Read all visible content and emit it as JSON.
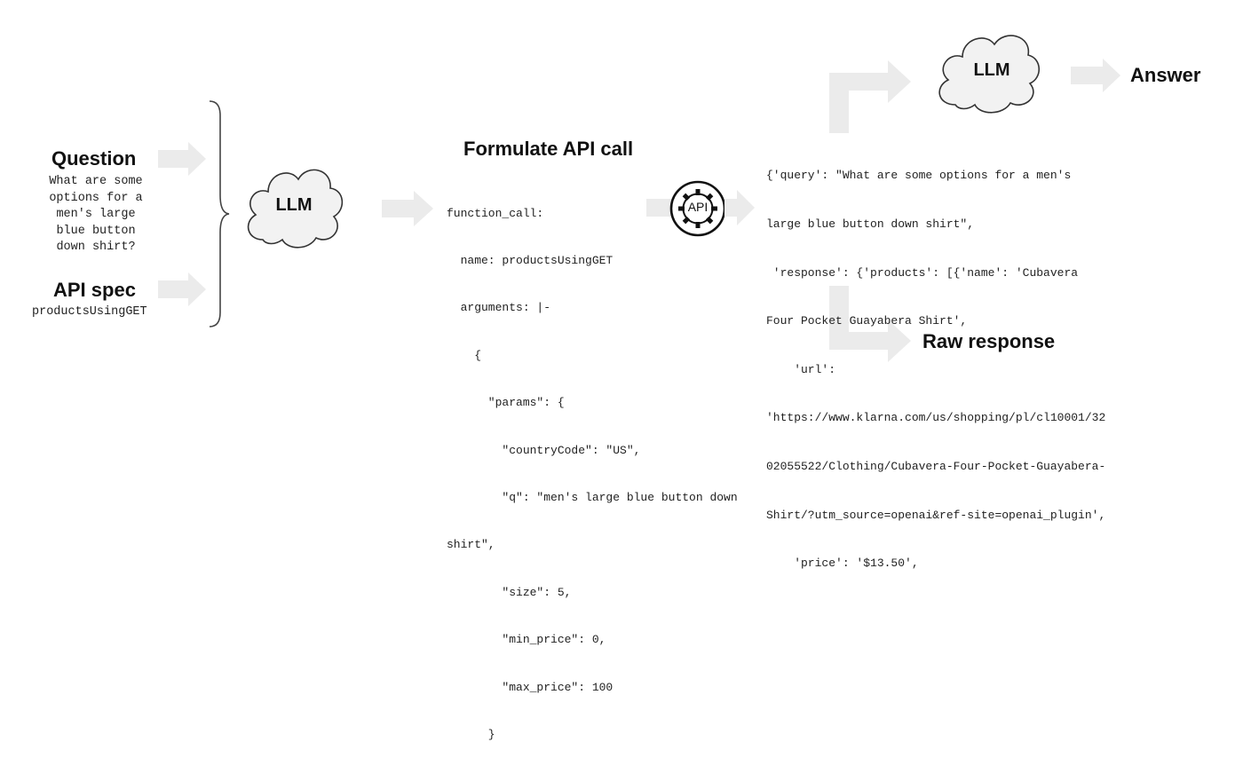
{
  "question": {
    "heading": "Question",
    "lines": [
      "What are some",
      "options for a",
      "men's large",
      "blue button",
      "down shirt?"
    ]
  },
  "api_spec": {
    "heading": "API spec",
    "value": "productsUsingGET"
  },
  "llm_left": {
    "label": "LLM"
  },
  "formulate": {
    "heading": "Formulate API call",
    "code_lines": [
      "function_call:",
      "  name: productsUsingGET",
      "  arguments: |-",
      "    {",
      "      \"params\": {",
      "        \"countryCode\": \"US\",",
      "        \"q\": \"men's large blue button down",
      "shirt\",",
      "        \"size\": 5,",
      "        \"min_price\": 0,",
      "        \"max_price\": 100",
      "      }"
    ]
  },
  "api_badge": {
    "label": "API",
    "icon": "api-gear-icon"
  },
  "response": {
    "code_lines": [
      "{'query': \"What are some options for a men's",
      "large blue button down shirt\",",
      " 'response': {'products': [{'name': 'Cubavera",
      "Four Pocket Guayabera Shirt',",
      "    'url':",
      "'https://www.klarna.com/us/shopping/pl/cl10001/32",
      "02055522/Clothing/Cubavera-Four-Pocket-Guayabera-",
      "Shirt/?utm_source=openai&ref-site=openai_plugin',",
      "    'price': '$13.50',"
    ]
  },
  "llm_right": {
    "label": "LLM"
  },
  "answer": {
    "label": "Answer"
  },
  "raw_response": {
    "label": "Raw response"
  },
  "colors": {
    "arrow": "#ebebeb",
    "cloud_fill": "#f2f2f2",
    "cloud_stroke": "#333333"
  }
}
